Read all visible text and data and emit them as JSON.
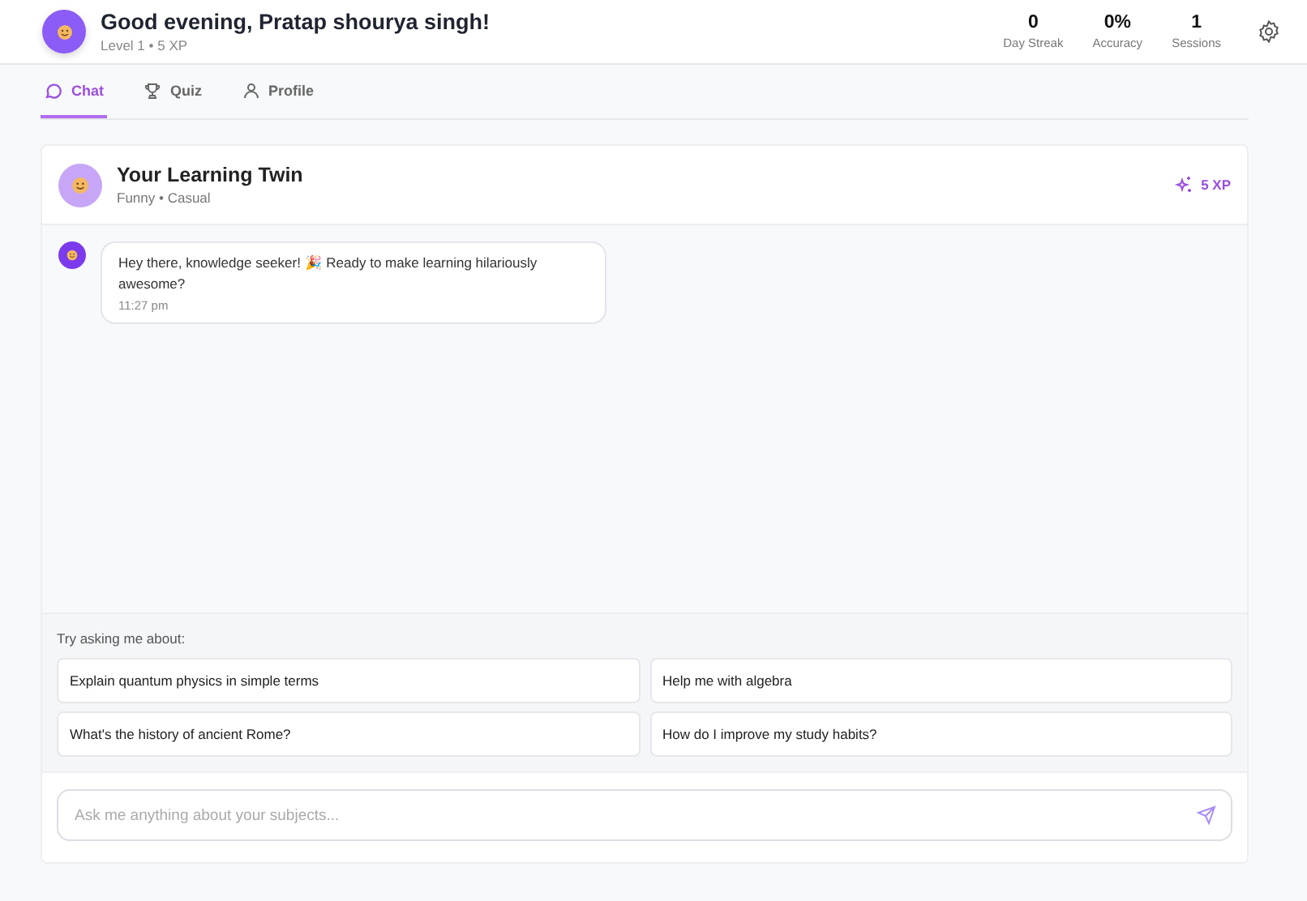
{
  "header": {
    "greeting": "Good evening, Pratap shourya singh!",
    "subtitle": "Level 1 • 5 XP",
    "stats": [
      {
        "value": "0",
        "label": "Day Streak"
      },
      {
        "value": "0%",
        "label": "Accuracy"
      },
      {
        "value": "1",
        "label": "Sessions"
      }
    ]
  },
  "tabs": [
    {
      "label": "Chat",
      "selected": true
    },
    {
      "label": "Quiz",
      "selected": false
    },
    {
      "label": "Profile",
      "selected": false
    }
  ],
  "chat": {
    "title": "Your Learning Twin",
    "subtitle": "Funny • Casual",
    "xp": "5 XP",
    "messages": [
      {
        "text": "Hey there, knowledge seeker! 🎉 Ready to make learning hilariously awesome?",
        "time": "11:27 pm"
      }
    ],
    "suggestions_title": "Try asking me about:",
    "suggestions": [
      "Explain quantum physics in simple terms",
      "Help me with algebra",
      "What's the history of ancient Rome?",
      "How do I improve my study habits?"
    ],
    "input": {
      "placeholder": "Ask me anything about your subjects..."
    }
  }
}
